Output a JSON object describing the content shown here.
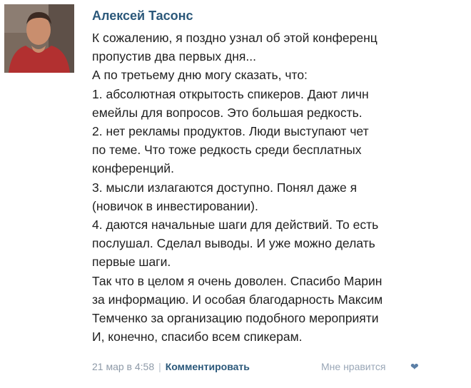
{
  "post": {
    "author": "Алексей Тасонс",
    "avatar_icon": "user-photo",
    "lines": [
      "К сожалению, я поздно узнал об этой конференц",
      "пропустив два первых дня...",
      "А по третьему дню могу сказать, что:",
      "1. абсолютная открытость спикеров. Дают личн",
      "емейлы для вопросов. Это большая редкость.",
      "2. нет рекламы продуктов. Люди выступают чет",
      "по теме. Что тоже редкость среди бесплатных",
      "конференций.",
      "3. мысли излагаются доступно. Понял даже я",
      "(новичок в инвестировании).",
      "4. даются начальные шаги для действий. То есть",
      "послушал. Сделал выводы. И уже можно делать",
      "первые шаги.",
      "Так что в целом я очень доволен. Спасибо Марин",
      "за информацию. И особая благодарность Максим",
      "Темченко за организацию подобного мероприяти",
      "И, конечно, спасибо всем спикерам."
    ],
    "footer": {
      "date": "21 мар в 4:58",
      "separator": "|",
      "comment_label": "Комментировать",
      "like_label": "Мне нравится",
      "like_icon": "heart-icon"
    }
  },
  "colors": {
    "author": "#2b587a",
    "text": "#1f1f1f",
    "date": "#8e9aa8",
    "like": "#9aa7b7"
  }
}
